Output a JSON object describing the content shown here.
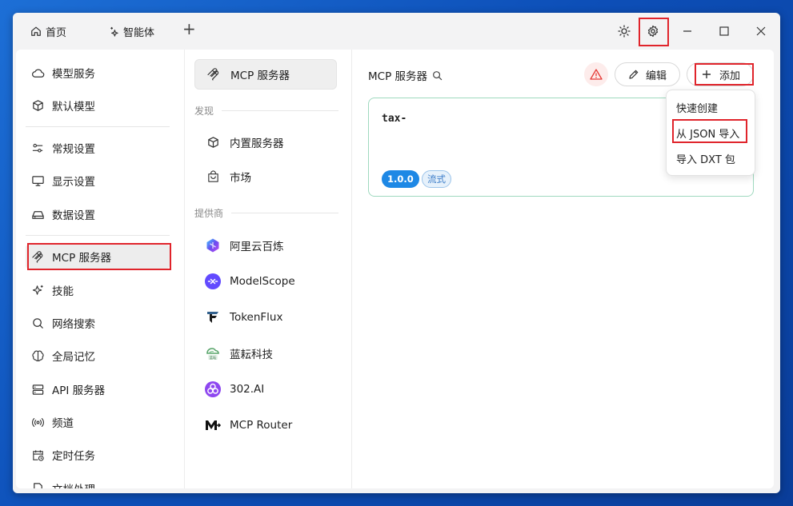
{
  "tabs": [
    {
      "label": "首页",
      "icon": "home-icon"
    },
    {
      "label": "智能体",
      "icon": "sparkle-icon"
    }
  ],
  "titlebar": {
    "new_tab": "+",
    "theme_icon": "sun-icon",
    "settings_icon": "gear-icon"
  },
  "nav": {
    "items": [
      {
        "label": "模型服务",
        "icon": "cloud-icon"
      },
      {
        "label": "默认模型",
        "icon": "cube-icon"
      },
      {
        "label": "常规设置",
        "icon": "sliders-icon"
      },
      {
        "label": "显示设置",
        "icon": "monitor-icon"
      },
      {
        "label": "数据设置",
        "icon": "hard-drive-icon"
      },
      {
        "label": "MCP 服务器",
        "icon": "mcp-icon"
      },
      {
        "label": "技能",
        "icon": "sparkles-icon"
      },
      {
        "label": "网络搜索",
        "icon": "search-icon"
      },
      {
        "label": "全局记忆",
        "icon": "brain-icon"
      },
      {
        "label": "API 服务器",
        "icon": "server-icon"
      },
      {
        "label": "频道",
        "icon": "broadcast-icon"
      },
      {
        "label": "定时任务",
        "icon": "calendar-clock-icon"
      },
      {
        "label": "文档处理",
        "icon": "document-icon"
      }
    ]
  },
  "sub": {
    "header": "MCP 服务器",
    "discover_heading": "发现",
    "discover": [
      {
        "label": "内置服务器",
        "icon": "package-icon"
      },
      {
        "label": "市场",
        "icon": "shopping-bag-icon"
      }
    ],
    "providers_heading": "提供商",
    "providers": [
      {
        "label": "阿里云百炼",
        "icon": "bailian-logo-icon",
        "color": "#6a4cf0"
      },
      {
        "label": "ModelScope",
        "icon": "modelscope-logo-icon",
        "color": "#624aff"
      },
      {
        "label": "TokenFlux",
        "icon": "tokenflux-logo-icon",
        "color": "#1a1a1a"
      },
      {
        "label": "蓝耘科技",
        "icon": "lanyun-logo-icon",
        "color": "#5aa56b"
      },
      {
        "label": "302.AI",
        "icon": "302ai-logo-icon",
        "color": "#8e47f0"
      },
      {
        "label": "MCP Router",
        "icon": "mcp-router-logo-icon",
        "color": "#111111"
      }
    ]
  },
  "main": {
    "title": "MCP 服务器",
    "edit_label": "编辑",
    "add_label": "添加",
    "card": {
      "name": "tax-",
      "version": "1.0.0",
      "tag": "流式"
    },
    "dropdown": [
      "快速创建",
      "从 JSON 导入",
      "导入 DXT 包"
    ]
  },
  "colors": {
    "accent": "#1e88e5",
    "highlight": "#e0242b",
    "card_border": "#9fd9bf"
  }
}
